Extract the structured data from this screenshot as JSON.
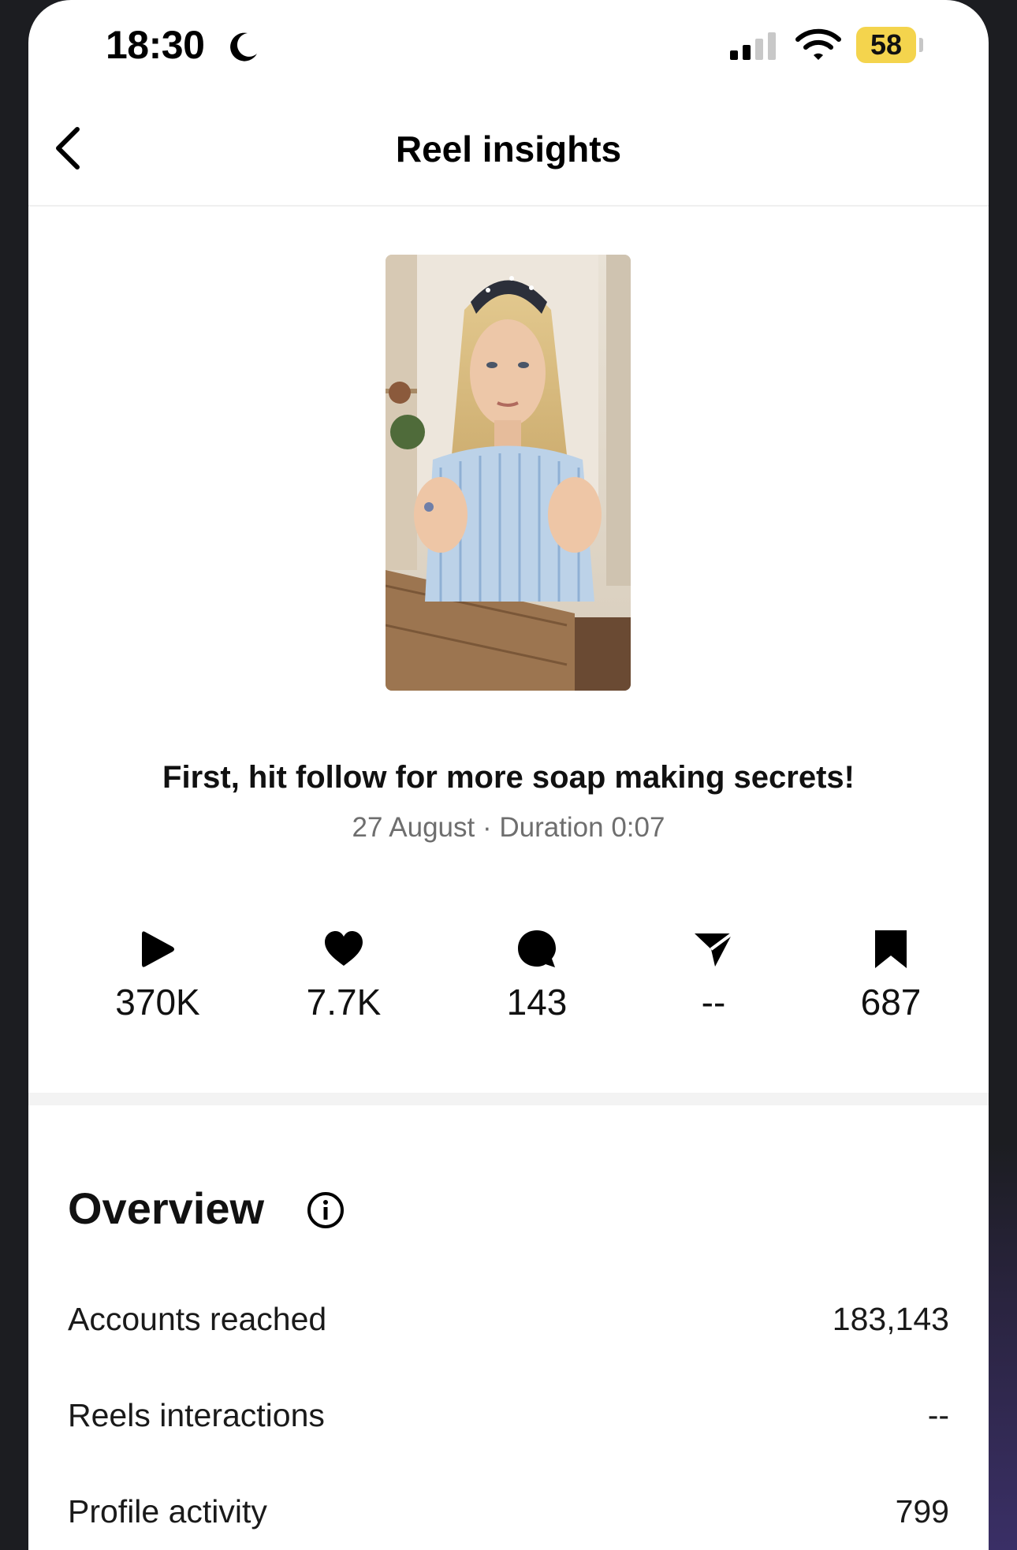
{
  "status_bar": {
    "time": "18:30",
    "battery": "58"
  },
  "header": {
    "title": "Reel insights"
  },
  "reel": {
    "title": "First, hit follow for more soap making secrets!",
    "meta": "27 August · Duration 0:07"
  },
  "stats": [
    {
      "icon": "play-icon",
      "value": "370K"
    },
    {
      "icon": "heart-icon",
      "value": "7.7K"
    },
    {
      "icon": "comment-icon",
      "value": "143"
    },
    {
      "icon": "share-icon",
      "value": "--"
    },
    {
      "icon": "bookmark-icon",
      "value": "687"
    }
  ],
  "overview": {
    "title": "Overview",
    "rows": [
      {
        "label": "Accounts reached",
        "value": "183,143"
      },
      {
        "label": "Reels interactions",
        "value": "--"
      },
      {
        "label": "Profile activity",
        "value": "799"
      }
    ]
  },
  "colors": {
    "battery": "#f4d44d",
    "meta_text": "#6e6e6e",
    "divider": "#f3f3f3"
  }
}
